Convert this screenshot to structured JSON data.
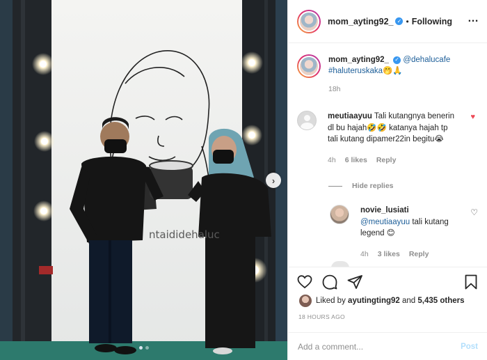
{
  "post": {
    "username": "mom_ayting92_",
    "follow_status": "Following",
    "separator": "•",
    "verified_mark": "✓",
    "more_icon": "ellipsis-icon",
    "wall_text": "ntaididehaluc"
  },
  "caption": {
    "username": "mom_ayting92_",
    "mention": "@dehalucafe",
    "hashtag": "#haluteruskaka",
    "emoji": "🤭🙏",
    "time": "18h"
  },
  "comments": [
    {
      "username": "meutiaayuu",
      "text": "Tali kutangnya benerin dl bu hajah🤣🤣 katanya hajah tp tali kutang dipamer22in begitu😭",
      "time": "4h",
      "likes": "6 likes",
      "reply_label": "Reply",
      "liked": true
    }
  ],
  "replies_toggle": "Hide replies",
  "replies": [
    {
      "username": "novie_lusiati",
      "mention": "@meutiaayuu",
      "text": "tali kutang legend 😊",
      "time": "4h",
      "likes": "3 likes",
      "reply_label": "Reply"
    }
  ],
  "likes": {
    "prefix": "Liked by",
    "user": "ayutingting92",
    "connector": "and",
    "count": "5,435 others"
  },
  "timestamp": "18 HOURS AGO",
  "comment_input": {
    "placeholder": "Add a comment...",
    "post_label": "Post"
  },
  "icons": {
    "next": "›",
    "heart_filled": "♥",
    "heart_outline": "♡"
  },
  "colors": {
    "accent": "#3897f0",
    "like_red": "#ed4956",
    "link": "#1e5f99",
    "muted": "#8e8e8e"
  },
  "carousel": {
    "current": 1,
    "total": 2
  }
}
